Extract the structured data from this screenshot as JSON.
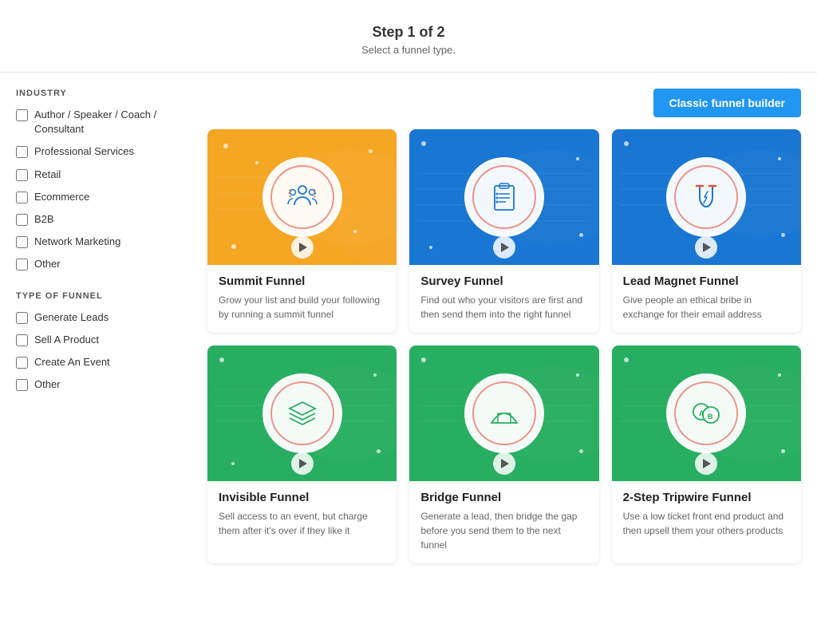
{
  "header": {
    "step_label": "Step 1 of 2",
    "subtitle": "Select a funnel type."
  },
  "sidebar": {
    "industry_title": "INDUSTRY",
    "industry_items": [
      {
        "id": "author",
        "label": "Author / Speaker / Coach / Consultant",
        "checked": false
      },
      {
        "id": "professional",
        "label": "Professional Services",
        "checked": false
      },
      {
        "id": "retail",
        "label": "Retail",
        "checked": false
      },
      {
        "id": "ecommerce",
        "label": "Ecommerce",
        "checked": false
      },
      {
        "id": "b2b",
        "label": "B2B",
        "checked": false
      },
      {
        "id": "network",
        "label": "Network Marketing",
        "checked": false
      },
      {
        "id": "other-industry",
        "label": "Other",
        "checked": false
      }
    ],
    "funnel_type_title": "TYPE OF FUNNEL",
    "funnel_type_items": [
      {
        "id": "generate-leads",
        "label": "Generate Leads",
        "checked": false
      },
      {
        "id": "sell-product",
        "label": "Sell A Product",
        "checked": false
      },
      {
        "id": "create-event",
        "label": "Create An Event",
        "checked": false
      },
      {
        "id": "other-funnel",
        "label": "Other",
        "checked": false
      }
    ]
  },
  "toolbar": {
    "classic_btn_label": "Classic funnel builder"
  },
  "funnels": [
    {
      "id": "summit",
      "title": "Summit Funnel",
      "description": "Grow your list and build your following by running a summit funnel",
      "color": "yellow",
      "icon": "summit"
    },
    {
      "id": "survey",
      "title": "Survey Funnel",
      "description": "Find out who your visitors are first and then send them into the right funnel",
      "color": "blue",
      "icon": "survey"
    },
    {
      "id": "lead-magnet",
      "title": "Lead Magnet Funnel",
      "description": "Give people an ethical bribe in exchange for their email address",
      "color": "blue2",
      "icon": "magnet"
    },
    {
      "id": "invisible",
      "title": "Invisible Funnel",
      "description": "Sell access to an event, but charge them after it's over if they like it",
      "color": "green",
      "icon": "layers"
    },
    {
      "id": "bridge",
      "title": "Bridge Funnel",
      "description": "Generate a lead, then bridge the gap before you send them to the next funnel",
      "color": "green2",
      "icon": "bridge"
    },
    {
      "id": "tripwire",
      "title": "2-Step Tripwire Funnel",
      "description": "Use a low ticket front end product and then upsell them your others products",
      "color": "green3",
      "icon": "coins"
    }
  ]
}
